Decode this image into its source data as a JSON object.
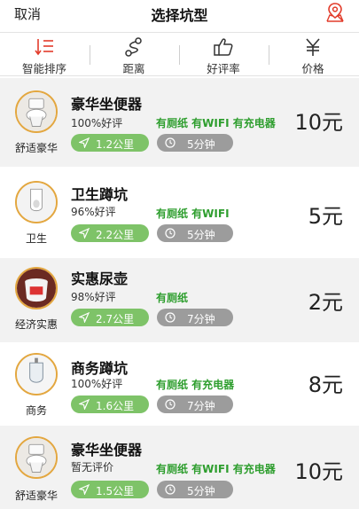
{
  "nav": {
    "cancel": "取消",
    "title": "选择坑型"
  },
  "sort": [
    {
      "label": "智能排序",
      "icon": "sort-list-icon",
      "color": "#e23b2a"
    },
    {
      "label": "距离",
      "icon": "route-icon"
    },
    {
      "label": "好评率",
      "icon": "thumbs-up-icon"
    },
    {
      "label": "价格",
      "icon": "yen-icon"
    }
  ],
  "colors": {
    "accent_red": "#e23b2a",
    "green_text": "#2e9e2e",
    "distance_pill": "#7ec368",
    "time_pill": "#9c9c9c",
    "avatar_ring": "#e3a740"
  },
  "items": [
    {
      "name": "豪华坐便器",
      "category": "舒适豪华",
      "rating": "100%好评",
      "amenities": "有厕纸 有WIFI 有充电器",
      "distance": "1.2公里",
      "time": "5分钟",
      "price": "10元",
      "icon": "toilet-icon"
    },
    {
      "name": "卫生蹲坑",
      "category": "卫生",
      "rating": "96%好评",
      "amenities": "有厕纸 有WIFI",
      "distance": "2.2公里",
      "time": "5分钟",
      "price": "5元",
      "icon": "squat-toilet-icon"
    },
    {
      "name": "实惠尿壶",
      "category": "经济实惠",
      "rating": "98%好评",
      "amenities": "有厕纸",
      "distance": "2.7公里",
      "time": "7分钟",
      "price": "2元",
      "icon": "chamber-pot-icon"
    },
    {
      "name": "商务蹲坑",
      "category": "商务",
      "rating": "100%好评",
      "amenities": "有厕纸 有充电器",
      "distance": "1.6公里",
      "time": "7分钟",
      "price": "8元",
      "icon": "urinal-icon"
    },
    {
      "name": "豪华坐便器",
      "category": "舒适豪华",
      "rating": "暂无评价",
      "amenities": "有厕纸 有WIFI 有充电器",
      "distance": "1.5公里",
      "time": "5分钟",
      "price": "10元",
      "icon": "toilet-icon"
    }
  ]
}
